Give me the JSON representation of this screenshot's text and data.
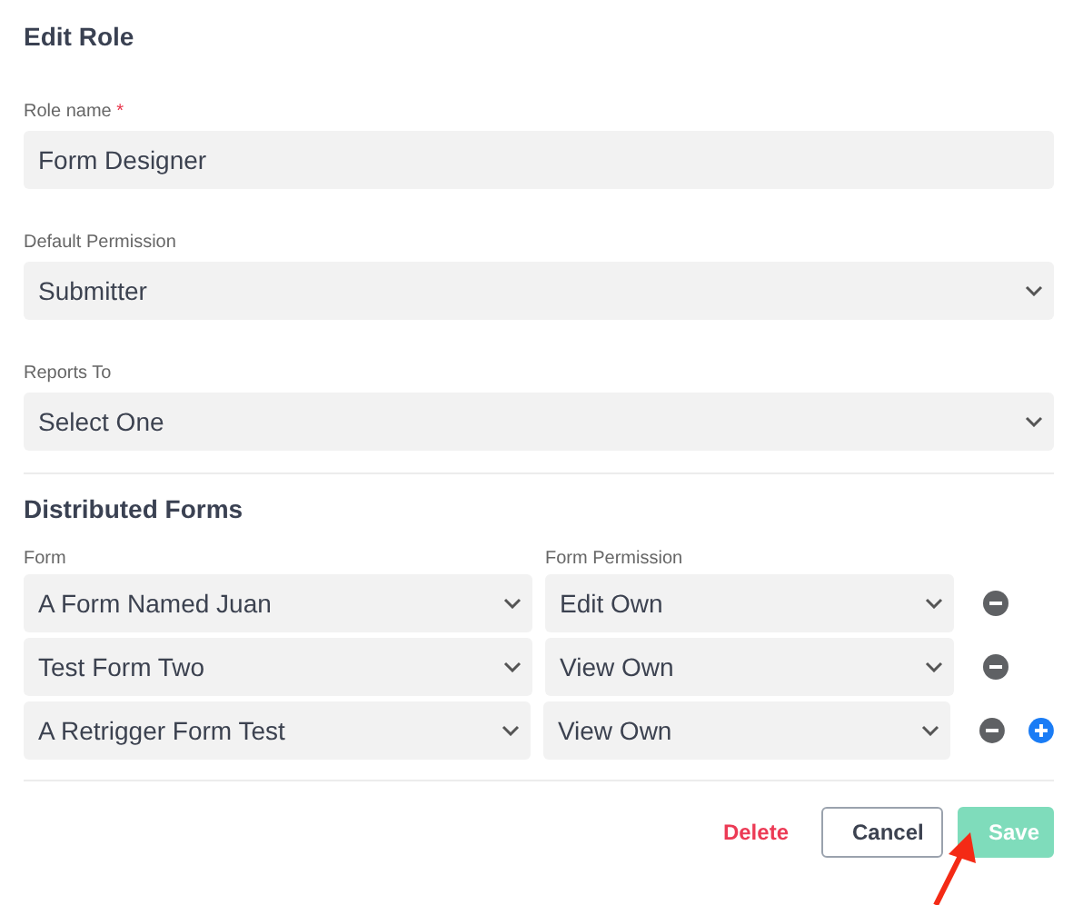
{
  "title": "Edit Role",
  "fields": [
    {
      "label": "Role name",
      "required_mark": "*",
      "kind": "text",
      "value": "Form Designer"
    },
    {
      "label": "Default Permission",
      "kind": "select",
      "value": "Submitter"
    },
    {
      "label": "Reports To",
      "kind": "select",
      "value": "Select One"
    }
  ],
  "distributed_forms": {
    "title": "Distributed Forms",
    "column_1": "Form",
    "column_2": "Form Permission",
    "rows": [
      {
        "form": "A Form Named Juan",
        "permission": "Edit Own",
        "add": false
      },
      {
        "form": "Test Form Two",
        "permission": "View Own",
        "add": false
      },
      {
        "form": "A Retrigger Form Test",
        "permission": "View Own",
        "add": true
      }
    ]
  },
  "buttons": [
    {
      "label": "Delete",
      "kind": "danger",
      "disabled": false
    },
    {
      "label": "Cancel",
      "kind": "outline",
      "disabled": false
    },
    {
      "label": "Save",
      "kind": "primary",
      "disabled": true
    }
  ],
  "annotation": {
    "kind": "arrow"
  }
}
